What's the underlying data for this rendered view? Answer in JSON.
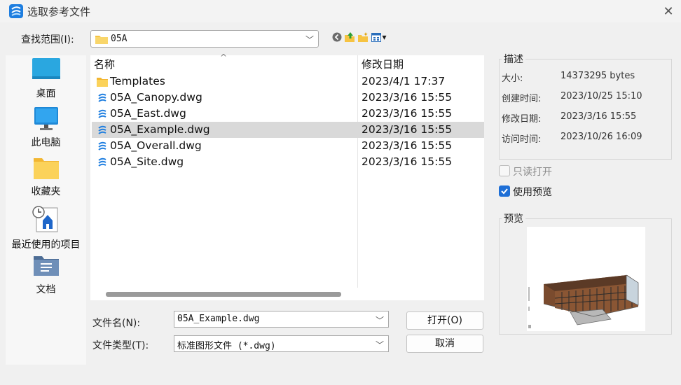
{
  "window": {
    "title": "选取参考文件",
    "close_glyph": "✕"
  },
  "lookin": {
    "label": "查找范围(I):",
    "path": "05A"
  },
  "toolbar": {
    "icons": [
      "back-icon",
      "up-folder-icon",
      "new-folder-icon",
      "view-menu-icon"
    ],
    "view_caret": "▾"
  },
  "sidebar": {
    "items": [
      {
        "label": "桌面",
        "icon": "desktop-icon"
      },
      {
        "label": "此电脑",
        "icon": "computer-icon"
      },
      {
        "label": "收藏夹",
        "icon": "favorites-folder-icon"
      },
      {
        "label": "最近使用的项目",
        "icon": "recent-items-icon"
      },
      {
        "label": "文档",
        "icon": "documents-icon"
      }
    ]
  },
  "filelist": {
    "columns": {
      "name": "名称",
      "date": "修改日期"
    },
    "sort_caret": "^",
    "rows": [
      {
        "name": "Templates",
        "date": "2023/4/1 17:37",
        "type": "folder"
      },
      {
        "name": "05A_Canopy.dwg",
        "date": "2023/3/16 15:55",
        "type": "dwg"
      },
      {
        "name": "05A_East.dwg",
        "date": "2023/3/16 15:55",
        "type": "dwg"
      },
      {
        "name": "05A_Example.dwg",
        "date": "2023/3/16 15:55",
        "type": "dwg",
        "selected": true
      },
      {
        "name": "05A_Overall.dwg",
        "date": "2023/3/16 15:55",
        "type": "dwg"
      },
      {
        "name": "05A_Site.dwg",
        "date": "2023/3/16 15:55",
        "type": "dwg"
      }
    ]
  },
  "filename": {
    "label": "文件名(N):",
    "value": "05A_Example.dwg"
  },
  "filetype": {
    "label": "文件类型(T):",
    "value": "标准图形文件 (*.dwg)"
  },
  "buttons": {
    "open": "打开(O)",
    "cancel": "取消"
  },
  "description": {
    "title": "描述",
    "size_label": "大小:",
    "size_value": "14373295 bytes",
    "created_label": "创建时间:",
    "created_value": "2023/10/25 15:10",
    "modified_label": "修改日期:",
    "modified_value": "2023/3/16 15:55",
    "accessed_label": "访问时间:",
    "accessed_value": "2023/10/26 16:09"
  },
  "options": {
    "readonly_label": "只读打开",
    "readonly_checked": false,
    "preview_label": "使用预览",
    "preview_checked": true
  },
  "preview": {
    "title": "预览"
  },
  "colors": {
    "accent": "#1e6fd6",
    "selected_row": "#d9d9d9",
    "folder": "#f6c342"
  }
}
